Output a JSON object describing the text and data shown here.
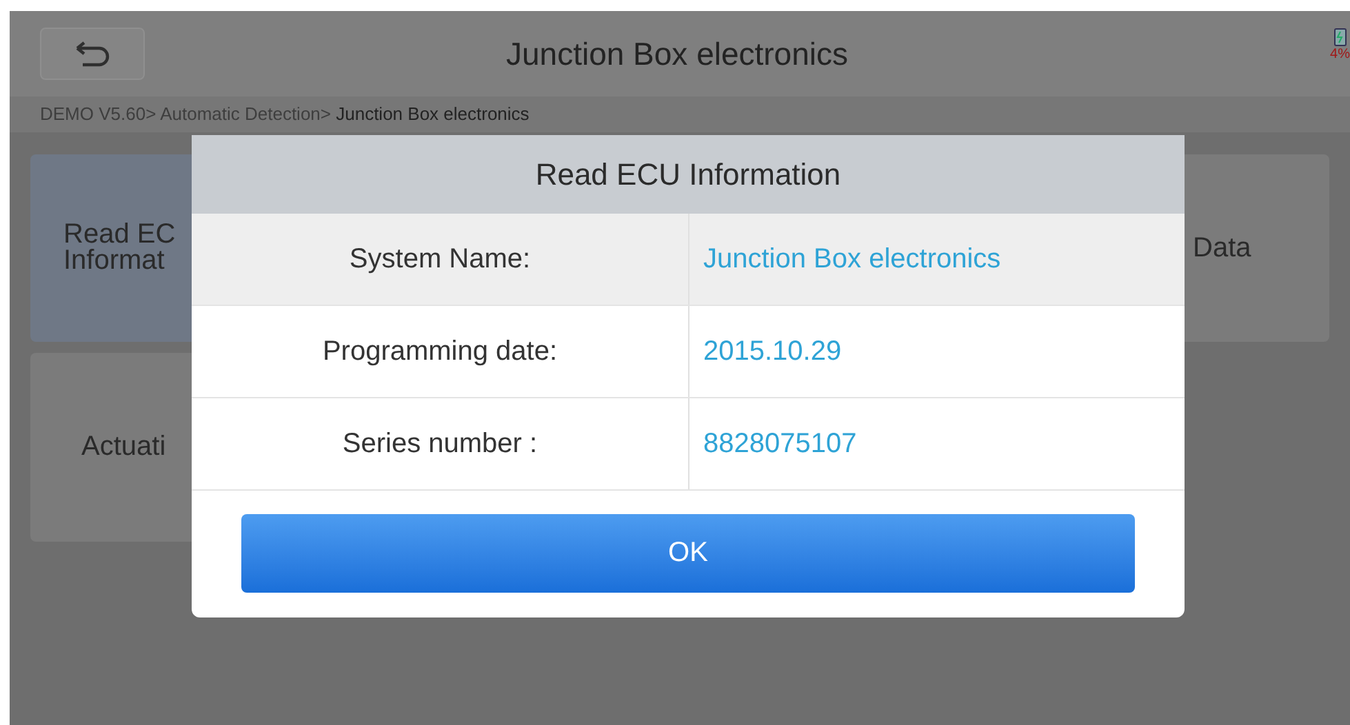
{
  "header": {
    "title": "Junction Box electronics",
    "battery": "4%"
  },
  "breadcrumb": {
    "path": "DEMO V5.60> Automatic Detection>",
    "current": " Junction Box electronics"
  },
  "tiles": [
    {
      "lines": [
        "Read EC",
        "Informat"
      ],
      "selected": true
    },
    {
      "lines": [
        "Data"
      ],
      "selected": false
    },
    {
      "lines": [
        "Actuati"
      ],
      "selected": false
    }
  ],
  "dialog": {
    "title": "Read ECU Information",
    "rows": [
      {
        "label": "System Name:",
        "value": "Junction Box electronics"
      },
      {
        "label": "Programming date:",
        "value": "2015.10.29"
      },
      {
        "label": "Series number :",
        "value": "8828075107"
      }
    ],
    "button": "OK"
  }
}
